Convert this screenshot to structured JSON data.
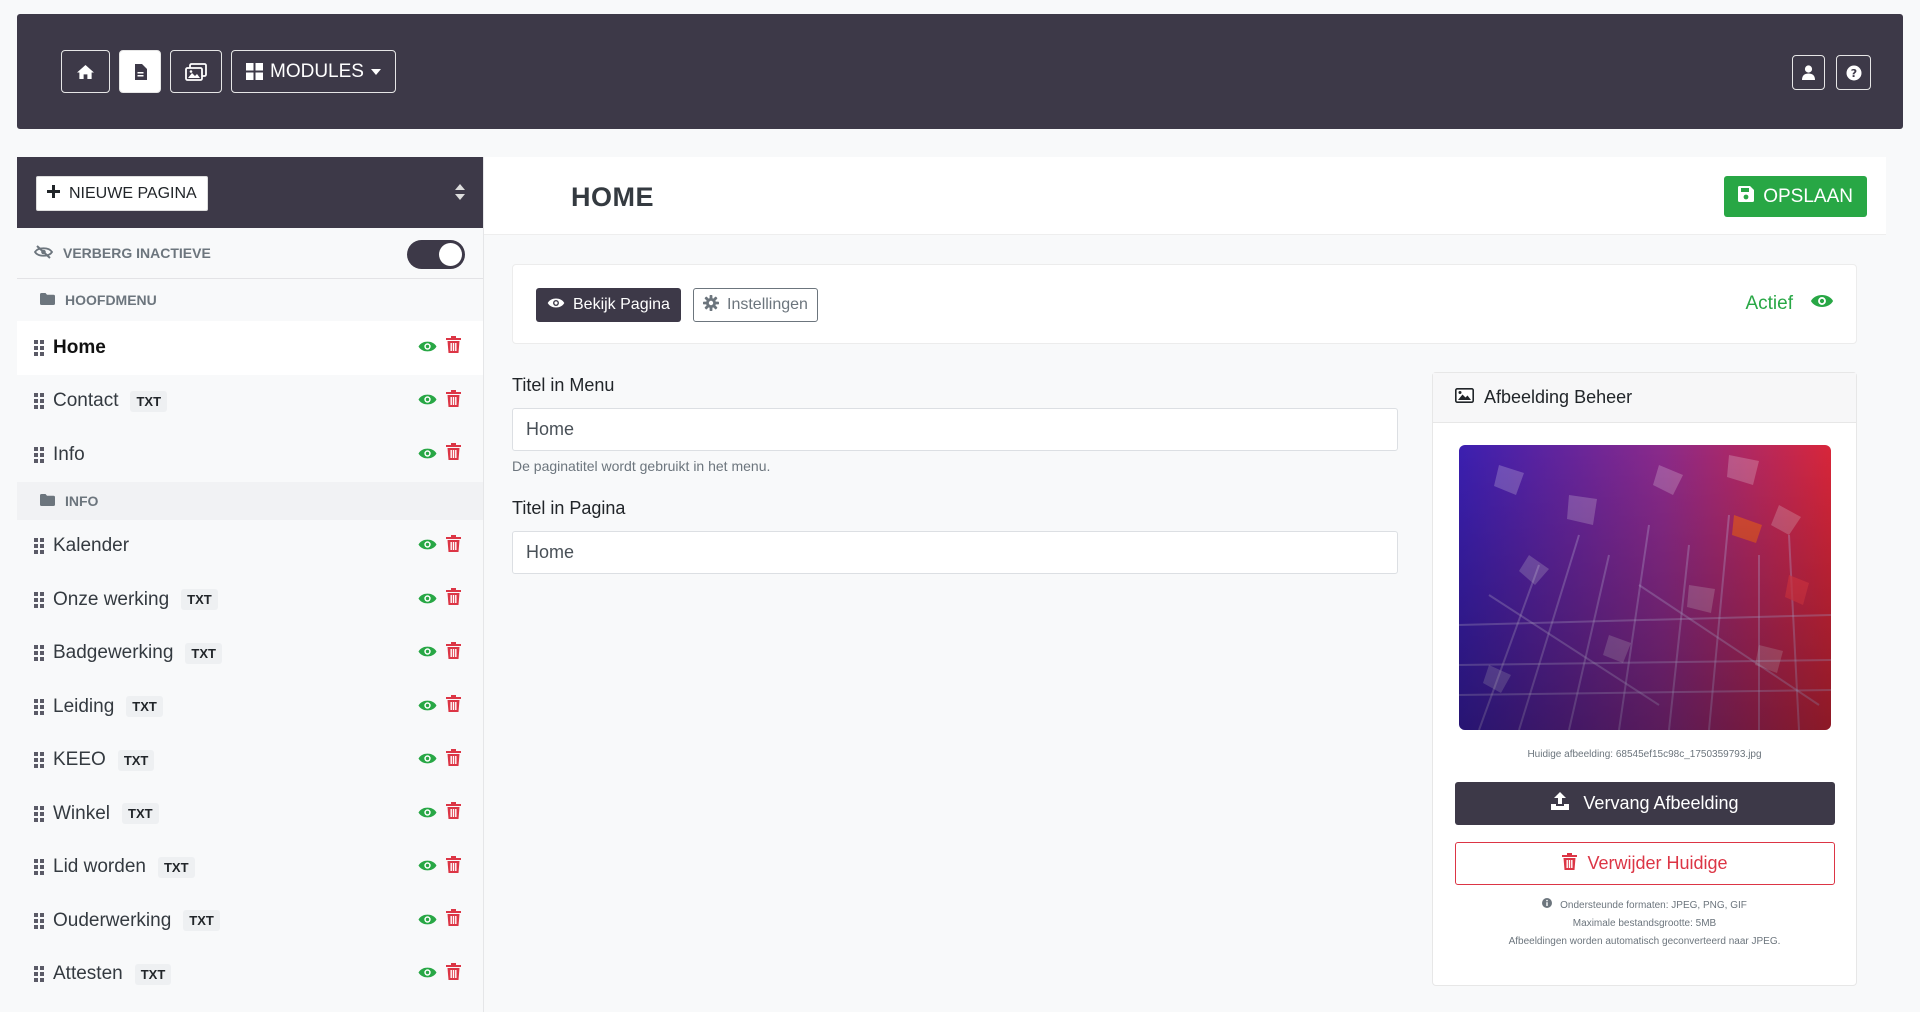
{
  "navbar": {
    "modules_label": "MODULES"
  },
  "sidebar": {
    "new_page_label": "NIEUWE PAGINA",
    "hide_inactive_label": "VERBERG INACTIEVE",
    "groups": [
      {
        "name": "HOOFDMENU",
        "items": [
          {
            "label": "Home",
            "badge": ""
          },
          {
            "label": "Contact",
            "badge": "TXT"
          },
          {
            "label": "Info",
            "badge": ""
          }
        ]
      },
      {
        "name": "INFO",
        "items": [
          {
            "label": "Kalender",
            "badge": ""
          },
          {
            "label": "Onze werking",
            "badge": "TXT"
          },
          {
            "label": "Badgewerking",
            "badge": "TXT"
          },
          {
            "label": "Leiding",
            "badge": "TXT"
          },
          {
            "label": "KEEO",
            "badge": "TXT"
          },
          {
            "label": "Winkel",
            "badge": "TXT"
          },
          {
            "label": "Lid worden",
            "badge": "TXT"
          },
          {
            "label": "Ouderwerking",
            "badge": "TXT"
          },
          {
            "label": "Attesten",
            "badge": "TXT"
          }
        ]
      }
    ]
  },
  "header": {
    "title": "HOME",
    "save_label": "OPSLAAN"
  },
  "toolbar": {
    "view_label": "Bekijk Pagina",
    "settings_label": "Instellingen",
    "status_label": "Actief"
  },
  "form": {
    "menu_title_label": "Titel in Menu",
    "menu_title_value": "Home",
    "menu_title_help": "De paginatitel wordt gebruikt in het menu.",
    "page_title_label": "Titel in Pagina",
    "page_title_value": "Home"
  },
  "image_card": {
    "title": "Afbeelding Beheer",
    "current_image": "Huidige afbeelding: 68545ef15c98c_1750359793.jpg",
    "replace_label": "Vervang Afbeelding",
    "delete_label": "Verwijder Huidige",
    "formats": "Ondersteunde formaten: JPEG, PNG, GIF",
    "max_size": "Maximale bestandsgrootte: 5MB",
    "convert_note": "Afbeeldingen worden automatisch geconverteerd naar JPEG."
  },
  "colors": {
    "dark": "#3d3948",
    "success": "#28a745",
    "danger": "#dc3545",
    "active_row": "#e9ecef"
  }
}
